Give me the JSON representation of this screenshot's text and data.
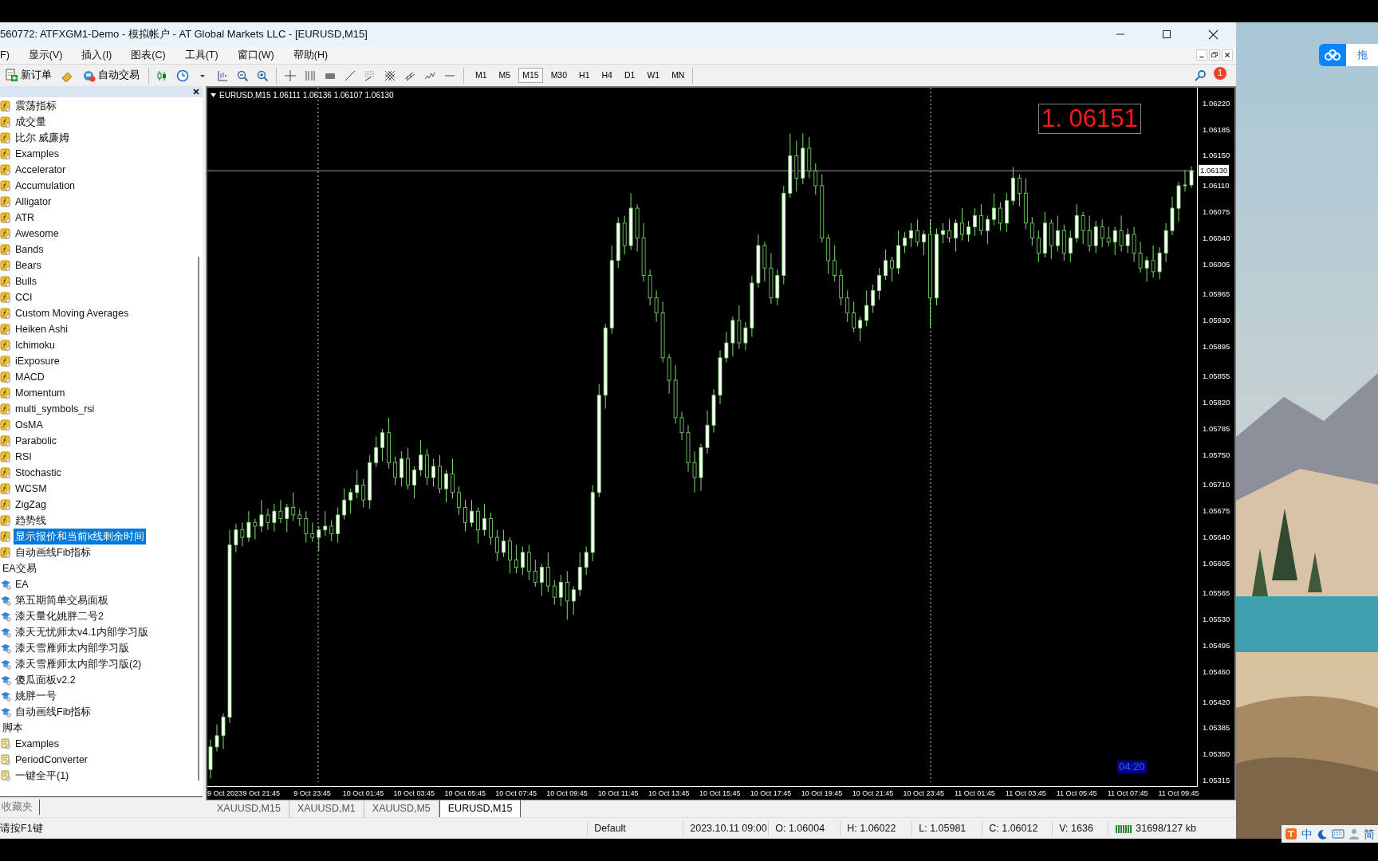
{
  "window": {
    "title": "560772: ATFXGM1-Demo - 模拟帐户 - AT Global Markets LLC - [EURUSD,M15]"
  },
  "menu": [
    "F)",
    "显示(V)",
    "插入(I)",
    "图表(C)",
    "工具(T)",
    "窗口(W)",
    "帮助(H)"
  ],
  "toolbar": {
    "buttons": [
      {
        "kind": "new_order",
        "label": "新订单"
      },
      {
        "kind": "auto_trading",
        "label": "自动交易"
      }
    ],
    "periods": [
      {
        "label": "M1",
        "selected": false
      },
      {
        "label": "M5",
        "selected": false
      },
      {
        "label": "M15",
        "selected": true
      },
      {
        "label": "M30",
        "selected": false
      },
      {
        "label": "H1",
        "selected": false
      },
      {
        "label": "H4",
        "selected": false
      },
      {
        "label": "D1",
        "selected": false
      },
      {
        "label": "W1",
        "selected": false
      },
      {
        "label": "MN",
        "selected": false
      }
    ],
    "notifications": "1"
  },
  "navigator": {
    "tree": [
      {
        "children": [
          {
            "label": "震荡指标",
            "kind": "indicator",
            "selected": false
          },
          {
            "label": "成交量",
            "kind": "indicator",
            "selected": false
          },
          {
            "label": "比尔 威廉姆",
            "kind": "indicator",
            "selected": false
          },
          {
            "label": "Examples",
            "kind": "indicator",
            "selected": false
          },
          {
            "label": "Accelerator",
            "kind": "indicator",
            "selected": false
          },
          {
            "label": "Accumulation",
            "kind": "indicator",
            "selected": false
          },
          {
            "label": "Alligator",
            "kind": "indicator",
            "selected": false
          },
          {
            "label": "ATR",
            "kind": "indicator",
            "selected": false
          },
          {
            "label": "Awesome",
            "kind": "indicator",
            "selected": false
          },
          {
            "label": "Bands",
            "kind": "indicator",
            "selected": false
          },
          {
            "label": "Bears",
            "kind": "indicator",
            "selected": false
          },
          {
            "label": "Bulls",
            "kind": "indicator",
            "selected": false
          },
          {
            "label": "CCI",
            "kind": "indicator",
            "selected": false
          },
          {
            "label": "Custom Moving Averages",
            "kind": "indicator",
            "selected": false
          },
          {
            "label": "Heiken Ashi",
            "kind": "indicator",
            "selected": false
          },
          {
            "label": "Ichimoku",
            "kind": "indicator",
            "selected": false
          },
          {
            "label": "iExposure",
            "kind": "indicator",
            "selected": false
          },
          {
            "label": "MACD",
            "kind": "indicator",
            "selected": false
          },
          {
            "label": "Momentum",
            "kind": "indicator",
            "selected": false
          },
          {
            "label": "multi_symbols_rsi",
            "kind": "indicator",
            "selected": false
          },
          {
            "label": "OsMA",
            "kind": "indicator",
            "selected": false
          },
          {
            "label": "Parabolic",
            "kind": "indicator",
            "selected": false
          },
          {
            "label": "RSI",
            "kind": "indicator",
            "selected": false
          },
          {
            "label": "Stochastic",
            "kind": "indicator",
            "selected": false
          },
          {
            "label": "WCSM",
            "kind": "indicator",
            "selected": false
          },
          {
            "label": "ZigZag",
            "kind": "indicator",
            "selected": false
          },
          {
            "label": "趋势线",
            "kind": "indicator",
            "selected": false
          },
          {
            "label": "显示报价和当前k线剩余时间",
            "kind": "indicator",
            "selected": true
          },
          {
            "label": "自动画线Fib指标",
            "kind": "indicator",
            "selected": false
          }
        ]
      },
      {
        "label": "EA交易",
        "selected": false,
        "children": [
          {
            "label": "EA",
            "kind": "expert",
            "selected": false
          },
          {
            "label": "第五期简单交易面板",
            "kind": "expert",
            "selected": false
          },
          {
            "label": "漆天量化姚胖二号2",
            "kind": "expert",
            "selected": false
          },
          {
            "label": "漆天无忧师太v4.1内部学习版",
            "kind": "expert",
            "selected": false
          },
          {
            "label": "漆天雪雁师太内部学习版",
            "kind": "expert",
            "selected": false
          },
          {
            "label": "漆天雪雁师太内部学习版(2)",
            "kind": "expert",
            "selected": false
          },
          {
            "label": "傻瓜面板v2.2",
            "kind": "expert",
            "selected": false
          },
          {
            "label": "姚胖一号",
            "kind": "expert",
            "selected": false
          },
          {
            "label": "自动画线Fib指标",
            "kind": "expert",
            "selected": false
          }
        ]
      },
      {
        "label": "脚本",
        "selected": false,
        "children": [
          {
            "label": "Examples",
            "kind": "script",
            "selected": false
          },
          {
            "label": "PeriodConverter",
            "kind": "script",
            "selected": false
          },
          {
            "label": "一键全平(1)",
            "kind": "script",
            "selected": false
          }
        ]
      }
    ],
    "tab": "收藏夹"
  },
  "chart": {
    "header": "EURUSD,M15  1.06111 1.06136 1.06107 1.06130",
    "big_price": "1. 06151",
    "timer": "04:20",
    "axis_start_label": "9 Oct 2023",
    "chart_data": {
      "type": "candlestick",
      "categories": [
        null,
        null,
        null,
        null,
        null,
        null,
        null,
        null,
        "9 Oct 21:45",
        null,
        null,
        null,
        null,
        null,
        null,
        null,
        "9 Oct 23:45",
        null,
        null,
        null,
        null,
        null,
        null,
        null,
        "10 Oct 01:45",
        null,
        null,
        null,
        null,
        null,
        null,
        null,
        "10 Oct 03:45",
        null,
        null,
        null,
        null,
        null,
        null,
        null,
        "10 Oct 05:45",
        null,
        null,
        null,
        null,
        null,
        null,
        null,
        "10 Oct 07:45",
        null,
        null,
        null,
        null,
        null,
        null,
        null,
        "10 Oct 09:45",
        null,
        null,
        null,
        null,
        null,
        null,
        null,
        "10 Oct 11:45",
        null,
        null,
        null,
        null,
        null,
        null,
        null,
        "10 Oct 13:45",
        null,
        null,
        null,
        null,
        null,
        null,
        null,
        "10 Oct 15:45",
        null,
        null,
        null,
        null,
        null,
        null,
        null,
        "10 Oct 17:45",
        null,
        null,
        null,
        null,
        null,
        null,
        null,
        "10 Oct 19:45",
        null,
        null,
        null,
        null,
        null,
        null,
        null,
        "10 Oct 21:45",
        null,
        null,
        null,
        null,
        null,
        null,
        null,
        "10 Oct 23:45",
        null,
        null,
        null,
        null,
        null,
        null,
        null,
        "11 Oct 01:45",
        null,
        null,
        null,
        null,
        null,
        null,
        null,
        "11 Oct 03:45",
        null,
        null,
        null,
        null,
        null,
        null,
        null,
        "11 Oct 05:45",
        null,
        null,
        null,
        null,
        null,
        null,
        null,
        "11 Oct 07:45",
        null,
        null,
        null,
        null,
        null,
        null,
        null,
        "11 Oct 09:45",
        null,
        null
      ],
      "ylim": [
        1.05313,
        1.06241
      ],
      "ref_lines": [
        {
          "axis": "y",
          "value": 1.0613,
          "label": "1.06130"
        }
      ],
      "yticks": [
        {
          "value": 1.0622,
          "label": "1.06220"
        },
        {
          "value": 1.06185,
          "label": "1.06185"
        },
        {
          "value": 1.0615,
          "label": "1.06150"
        },
        {
          "value": 1.0611,
          "label": "1.06110"
        },
        {
          "value": 1.06075,
          "label": "1.06075"
        },
        {
          "value": 1.0604,
          "label": "1.06040"
        },
        {
          "value": 1.06005,
          "label": "1.06005"
        },
        {
          "value": 1.05965,
          "label": "1.05965"
        },
        {
          "value": 1.0593,
          "label": "1.05930"
        },
        {
          "value": 1.05895,
          "label": "1.05895"
        },
        {
          "value": 1.05855,
          "label": "1.05855"
        },
        {
          "value": 1.0582,
          "label": "1.05820"
        },
        {
          "value": 1.05785,
          "label": "1.05785"
        },
        {
          "value": 1.0575,
          "label": "1.05750"
        },
        {
          "value": 1.0571,
          "label": "1.05710"
        },
        {
          "value": 1.05675,
          "label": "1.05675"
        },
        {
          "value": 1.0564,
          "label": "1.05640"
        },
        {
          "value": 1.05605,
          "label": "1.05605"
        },
        {
          "value": 1.05565,
          "label": "1.05565"
        },
        {
          "value": 1.0553,
          "label": "1.05530"
        },
        {
          "value": 1.05495,
          "label": "1.05495"
        },
        {
          "value": 1.0546,
          "label": "1.05460"
        },
        {
          "value": 1.0542,
          "label": "1.05420"
        },
        {
          "value": 1.05385,
          "label": "1.05385"
        },
        {
          "value": 1.0535,
          "label": "1.05350"
        },
        {
          "value": 1.05315,
          "label": "1.05315"
        }
      ],
      "ohlc": [
        [
          1.0533,
          1.0537,
          1.05318,
          1.0536
        ],
        [
          1.0536,
          1.0539,
          1.05354,
          1.05375
        ],
        [
          1.05375,
          1.05405,
          1.05357,
          1.054
        ],
        [
          1.054,
          1.0565,
          1.05392,
          1.0563
        ],
        [
          1.0563,
          1.05658,
          1.0562,
          1.0565
        ],
        [
          1.0565,
          1.0566,
          1.05628,
          1.0564
        ],
        [
          1.0564,
          1.05675,
          1.05634,
          1.0566
        ],
        [
          1.0566,
          1.05665,
          1.05637,
          1.05655
        ],
        [
          1.05655,
          1.0569,
          1.05647,
          1.0567
        ],
        [
          1.0567,
          1.05678,
          1.0565,
          1.0566
        ],
        [
          1.0566,
          1.05685,
          1.05648,
          1.05675
        ],
        [
          1.05675,
          1.0569,
          1.05659,
          1.05665
        ],
        [
          1.05665,
          1.05685,
          1.05647,
          1.0568
        ],
        [
          1.0568,
          1.057,
          1.05662,
          1.0567
        ],
        [
          1.0567,
          1.05678,
          1.05655,
          1.05665
        ],
        [
          1.05665,
          1.05675,
          1.05633,
          1.05645
        ],
        [
          1.05645,
          1.0566,
          1.05634,
          1.0564
        ],
        [
          1.0564,
          1.05655,
          1.05622,
          1.0565
        ],
        [
          1.0565,
          1.05675,
          1.05642,
          1.05655
        ],
        [
          1.05655,
          1.05663,
          1.05635,
          1.05645
        ],
        [
          1.05645,
          1.0568,
          1.05633,
          1.0567
        ],
        [
          1.0567,
          1.05705,
          1.05664,
          1.0569
        ],
        [
          1.0569,
          1.05705,
          1.05672,
          1.057
        ],
        [
          1.057,
          1.0573,
          1.05692,
          1.0571
        ],
        [
          1.0571,
          1.05718,
          1.0568,
          1.0569
        ],
        [
          1.0569,
          1.0575,
          1.05678,
          1.0574
        ],
        [
          1.0574,
          1.05775,
          1.05734,
          1.0576
        ],
        [
          1.0576,
          1.05785,
          1.05742,
          1.0578
        ],
        [
          1.0578,
          1.058,
          1.05732,
          1.0574
        ],
        [
          1.0574,
          1.05748,
          1.0571,
          1.0572
        ],
        [
          1.0572,
          1.05755,
          1.05708,
          1.05745
        ],
        [
          1.05745,
          1.0576,
          1.05704,
          1.0571
        ],
        [
          1.0571,
          1.05735,
          1.05692,
          1.0573
        ],
        [
          1.0573,
          1.0577,
          1.05722,
          1.0575
        ],
        [
          1.0575,
          1.05758,
          1.0571,
          1.0572
        ],
        [
          1.0572,
          1.05745,
          1.05708,
          1.05735
        ],
        [
          1.05735,
          1.0575,
          1.05699,
          1.05705
        ],
        [
          1.05705,
          1.0573,
          1.05687,
          1.05725
        ],
        [
          1.05725,
          1.05745,
          1.05692,
          1.057
        ],
        [
          1.057,
          1.05708,
          1.0567,
          1.0568
        ],
        [
          1.0568,
          1.0569,
          1.05648,
          1.0566
        ],
        [
          1.0566,
          1.0569,
          1.05654,
          1.05675
        ],
        [
          1.05675,
          1.0568,
          1.05632,
          1.0565
        ],
        [
          1.0565,
          1.05685,
          1.05642,
          1.05665
        ],
        [
          1.05665,
          1.05673,
          1.0563,
          1.0564
        ],
        [
          1.0564,
          1.0565,
          1.05608,
          1.0562
        ],
        [
          1.0562,
          1.0565,
          1.05614,
          1.05635
        ],
        [
          1.05635,
          1.0564,
          1.05592,
          1.0561
        ],
        [
          1.0561,
          1.0563,
          1.05592,
          1.056
        ],
        [
          1.056,
          1.05628,
          1.0559,
          1.0562
        ],
        [
          1.0562,
          1.0563,
          1.05583,
          1.05595
        ],
        [
          1.05595,
          1.0561,
          1.05574,
          1.0558
        ],
        [
          1.0558,
          1.05605,
          1.05562,
          1.056
        ],
        [
          1.056,
          1.0562,
          1.05567,
          1.05575
        ],
        [
          1.05575,
          1.05583,
          1.0555,
          1.0556
        ],
        [
          1.0556,
          1.0559,
          1.05548,
          1.0558
        ],
        [
          1.0558,
          1.05595,
          1.0553,
          1.05555
        ],
        [
          1.05555,
          1.05575,
          1.05537,
          1.0557
        ],
        [
          1.0557,
          1.0562,
          1.05562,
          1.056
        ],
        [
          1.056,
          1.05628,
          1.0559,
          1.0562
        ],
        [
          1.0562,
          1.0571,
          1.05608,
          1.057
        ],
        [
          1.057,
          1.05845,
          1.05694,
          1.0583
        ],
        [
          1.0583,
          1.05925,
          1.05812,
          1.0592
        ],
        [
          1.0592,
          1.0603,
          1.05912,
          1.0601
        ],
        [
          1.0601,
          1.06068,
          1.06,
          1.0606
        ],
        [
          1.0606,
          1.0607,
          1.06018,
          1.0603
        ],
        [
          1.0603,
          1.061,
          1.06024,
          1.0608
        ],
        [
          1.0608,
          1.06085,
          1.06022,
          1.0604
        ],
        [
          1.0604,
          1.0606,
          1.05982,
          1.0599
        ],
        [
          1.0599,
          1.05998,
          1.0595,
          1.0596
        ],
        [
          1.0596,
          1.0597,
          1.05928,
          1.0594
        ],
        [
          1.0594,
          1.05955,
          1.05874,
          1.0588
        ],
        [
          1.0588,
          1.05885,
          1.05832,
          1.0585
        ],
        [
          1.0585,
          1.0587,
          1.05792,
          1.058
        ],
        [
          1.058,
          1.05808,
          1.0577,
          1.0578
        ],
        [
          1.0578,
          1.0579,
          1.05728,
          1.0574
        ],
        [
          1.0574,
          1.05755,
          1.057,
          1.0572
        ],
        [
          1.0572,
          1.05765,
          1.05702,
          1.0576
        ],
        [
          1.0576,
          1.0581,
          1.05752,
          1.0579
        ],
        [
          1.0579,
          1.05838,
          1.0578,
          1.0583
        ],
        [
          1.0583,
          1.0589,
          1.05818,
          1.0588
        ],
        [
          1.0588,
          1.05915,
          1.05874,
          1.059
        ],
        [
          1.059,
          1.05935,
          1.05882,
          1.0593
        ],
        [
          1.0593,
          1.0595,
          1.05892,
          1.059
        ],
        [
          1.059,
          1.05928,
          1.0589,
          1.0592
        ],
        [
          1.0592,
          1.0599,
          1.05908,
          1.0598
        ],
        [
          1.0598,
          1.06045,
          1.05974,
          1.0603
        ],
        [
          1.0603,
          1.06035,
          1.05982,
          1.06
        ],
        [
          1.06,
          1.0602,
          1.05952,
          1.0596
        ],
        [
          1.0596,
          1.05998,
          1.0595,
          1.0599
        ],
        [
          1.0599,
          1.0611,
          1.05978,
          1.061
        ],
        [
          1.061,
          1.0618,
          1.06094,
          1.0615
        ],
        [
          1.0615,
          1.0617,
          1.06102,
          1.0612
        ],
        [
          1.0612,
          1.0618,
          1.06112,
          1.0616
        ],
        [
          1.0616,
          1.06175,
          1.0612,
          1.0613
        ],
        [
          1.0613,
          1.0614,
          1.06098,
          1.0611
        ],
        [
          1.0611,
          1.06125,
          1.06034,
          1.0604
        ],
        [
          1.0604,
          1.06045,
          1.05992,
          1.0601
        ],
        [
          1.0601,
          1.0603,
          1.05982,
          1.0599
        ],
        [
          1.0599,
          1.05998,
          1.0595,
          1.0596
        ],
        [
          1.0596,
          1.0597,
          1.05928,
          1.0594
        ],
        [
          1.0594,
          1.05955,
          1.05914,
          1.0592
        ],
        [
          1.0592,
          1.05935,
          1.05902,
          1.0593
        ],
        [
          1.0593,
          1.0597,
          1.05922,
          1.0595
        ],
        [
          1.0595,
          1.05978,
          1.0594,
          1.0597
        ],
        [
          1.0597,
          1.06,
          1.05958,
          1.0599
        ],
        [
          1.0599,
          1.06025,
          1.05984,
          1.0601
        ],
        [
          1.0601,
          1.06015,
          1.05982,
          1.06
        ],
        [
          1.06,
          1.0605,
          1.05992,
          1.0603
        ],
        [
          1.0603,
          1.06048,
          1.0602,
          1.0604
        ],
        [
          1.0604,
          1.0606,
          1.06028,
          1.0605
        ],
        [
          1.0605,
          1.06065,
          1.06029,
          1.06035
        ],
        [
          1.06035,
          1.0605,
          1.06017,
          1.06045
        ],
        [
          1.06045,
          1.06065,
          1.0592,
          1.0596
        ],
        [
          1.0596,
          1.06053,
          1.0595,
          1.06045
        ],
        [
          1.06045,
          1.0606,
          1.06033,
          1.0605
        ],
        [
          1.0605,
          1.06065,
          1.06034,
          1.0604
        ],
        [
          1.0604,
          1.06065,
          1.06022,
          1.0606
        ],
        [
          1.0606,
          1.0608,
          1.06037,
          1.06045
        ],
        [
          1.06045,
          1.06063,
          1.06035,
          1.06055
        ],
        [
          1.06055,
          1.0608,
          1.06043,
          1.0607
        ],
        [
          1.0607,
          1.06085,
          1.06044,
          1.0605
        ],
        [
          1.0605,
          1.0607,
          1.06032,
          1.06065
        ],
        [
          1.06065,
          1.061,
          1.06057,
          1.0608
        ],
        [
          1.0608,
          1.06088,
          1.0605,
          1.0606
        ],
        [
          1.0606,
          1.061,
          1.06048,
          1.0609
        ],
        [
          1.0609,
          1.06135,
          1.06084,
          1.0612
        ],
        [
          1.0612,
          1.06125,
          1.06082,
          1.061
        ],
        [
          1.061,
          1.0612,
          1.06052,
          1.0606
        ],
        [
          1.0606,
          1.06068,
          1.0603,
          1.0604
        ],
        [
          1.0604,
          1.0605,
          1.06008,
          1.0602
        ],
        [
          1.0602,
          1.06075,
          1.06014,
          1.0606
        ],
        [
          1.0606,
          1.06065,
          1.06012,
          1.0603
        ],
        [
          1.0603,
          1.0607,
          1.06022,
          1.0605
        ],
        [
          1.0605,
          1.06058,
          1.0601,
          1.0602
        ],
        [
          1.0602,
          1.0605,
          1.06008,
          1.0604
        ],
        [
          1.0604,
          1.06085,
          1.06034,
          1.0607
        ],
        [
          1.0607,
          1.06075,
          1.06032,
          1.0605
        ],
        [
          1.0605,
          1.0607,
          1.06022,
          1.0603
        ],
        [
          1.0603,
          1.06063,
          1.0602,
          1.06055
        ],
        [
          1.06055,
          1.06065,
          1.06028,
          1.0604
        ],
        [
          1.0604,
          1.06055,
          1.06029,
          1.06035
        ],
        [
          1.06035,
          1.06055,
          1.06017,
          1.0605
        ],
        [
          1.0605,
          1.0607,
          1.06022,
          1.0603
        ],
        [
          1.0603,
          1.06053,
          1.0602,
          1.06045
        ],
        [
          1.06045,
          1.06055,
          1.06008,
          1.0602
        ],
        [
          1.0602,
          1.06035,
          1.05994,
          1.06
        ],
        [
          1.06,
          1.06015,
          1.05982,
          1.0601
        ],
        [
          1.0601,
          1.0603,
          1.05987,
          1.05995
        ],
        [
          1.05995,
          1.06028,
          1.05985,
          1.0602
        ],
        [
          1.0602,
          1.0606,
          1.06008,
          1.0605
        ],
        [
          1.0605,
          1.06095,
          1.06044,
          1.0608
        ],
        [
          1.0608,
          1.06115,
          1.06062,
          1.0611
        ],
        [
          1.0611,
          1.06131,
          1.06102,
          1.06111
        ],
        [
          1.06111,
          1.06136,
          1.06107,
          1.0613
        ]
      ]
    }
  },
  "chart_tabs": [
    {
      "label": "XAUUSD,M15",
      "selected": false
    },
    {
      "label": "XAUUSD,M1",
      "selected": false
    },
    {
      "label": "XAUUSD,M5",
      "selected": false
    },
    {
      "label": "EURUSD,M15",
      "selected": true
    }
  ],
  "status_bar": [
    "请按F1键",
    "Default",
    "2023.10.11 09:00",
    "O: 1.06004",
    "H: 1.06022",
    "L: 1.05981",
    "C: 1.06012",
    "V: 1636",
    "31698/127 kb"
  ],
  "desktop": {
    "cloud_widget": "拖",
    "tray": [
      "中",
      "简"
    ]
  }
}
